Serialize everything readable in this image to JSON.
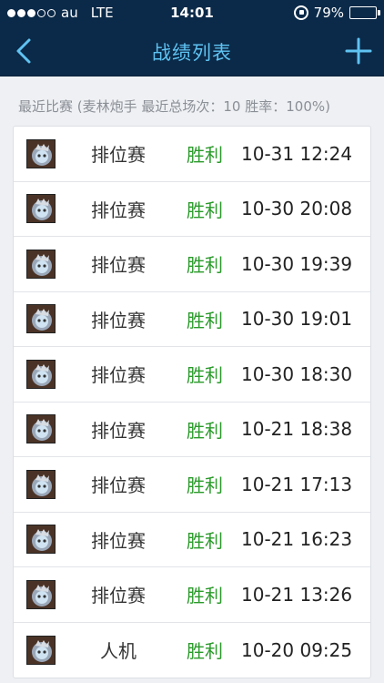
{
  "status_bar": {
    "carrier": "au",
    "network": "LTE",
    "time": "14:01",
    "battery": "79%"
  },
  "nav": {
    "title": "战绩列表",
    "back_icon": "chevron-left-icon",
    "add_icon": "plus-icon"
  },
  "summary": "最近比赛 (麦林炮手 最近总场次：10 胜率：100%)",
  "colors": {
    "nav_bg": "#0b2a49",
    "title": "#5fc3f2",
    "win": "#2a9a2a"
  },
  "matches": [
    {
      "mode": "排位赛",
      "result": "胜利",
      "time": "10-31 12:24"
    },
    {
      "mode": "排位赛",
      "result": "胜利",
      "time": "10-30 20:08"
    },
    {
      "mode": "排位赛",
      "result": "胜利",
      "time": "10-30 19:39"
    },
    {
      "mode": "排位赛",
      "result": "胜利",
      "time": "10-30 19:01"
    },
    {
      "mode": "排位赛",
      "result": "胜利",
      "time": "10-30 18:30"
    },
    {
      "mode": "排位赛",
      "result": "胜利",
      "time": "10-21 18:38"
    },
    {
      "mode": "排位赛",
      "result": "胜利",
      "time": "10-21 17:13"
    },
    {
      "mode": "排位赛",
      "result": "胜利",
      "time": "10-21 16:23"
    },
    {
      "mode": "排位赛",
      "result": "胜利",
      "time": "10-21 13:26"
    },
    {
      "mode": "人机",
      "result": "胜利",
      "time": "10-20 09:25"
    }
  ]
}
